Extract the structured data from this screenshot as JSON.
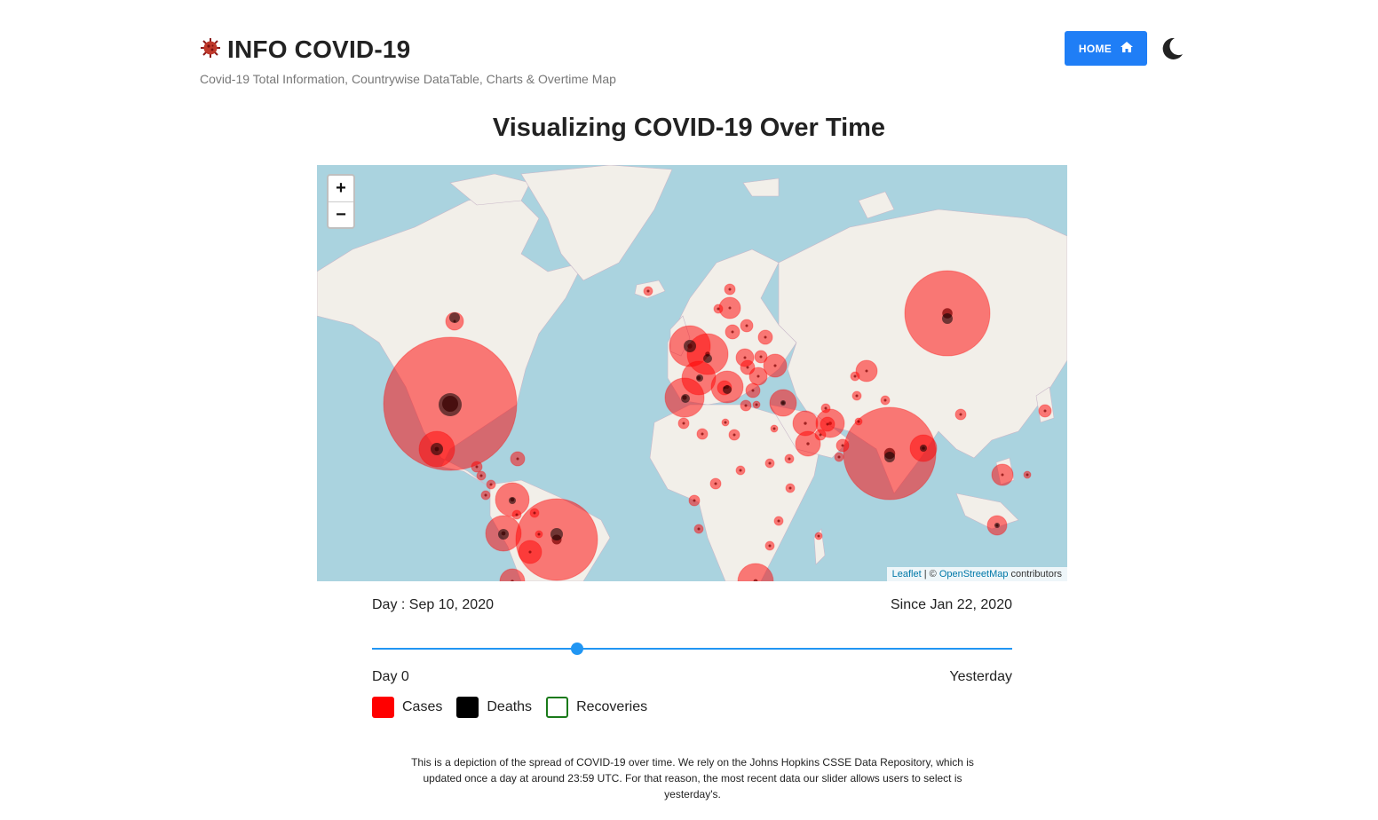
{
  "header": {
    "icon": "virus-icon",
    "title": "INFO COVID-19",
    "subtitle": "Covid-19 Total Information, Countrywise DataTable, Charts & Overtime Map",
    "home_label": "HOME",
    "home_icon": "home-icon",
    "theme_icon": "moon-icon"
  },
  "page_title": "Visualizing COVID-19 Over Time",
  "map": {
    "zoom_in": "+",
    "zoom_out": "−",
    "attribution_leaflet": "Leaflet",
    "attribution_sep": " | © ",
    "attribution_osm": "OpenStreetMap",
    "attribution_suffix": " contributors",
    "colors": {
      "water": "#aad3df",
      "land": "#f2efe9",
      "cases": "#ff0000",
      "deaths": "#000000"
    }
  },
  "timeline": {
    "day_label": "Day : Sep 10, 2020",
    "since_label": "Since Jan 22, 2020",
    "min_label": "Day 0",
    "max_label": "Yesterday",
    "slider_fraction": 0.32
  },
  "legend": [
    {
      "label": "Cases",
      "color": "#ff0000",
      "style": "filled"
    },
    {
      "label": "Deaths",
      "color": "#000000",
      "style": "filled"
    },
    {
      "label": "Recoveries",
      "color": "#1a7a1a",
      "style": "outline"
    }
  ],
  "description": "This is a depiction of the spread of COVID-19 over time. We rely on the Johns Hopkins CSSE Data Repository, which is updated once a day at around 23:59 UTC. For that reason, the most recent data our slider allows users to select is yesterday's."
}
